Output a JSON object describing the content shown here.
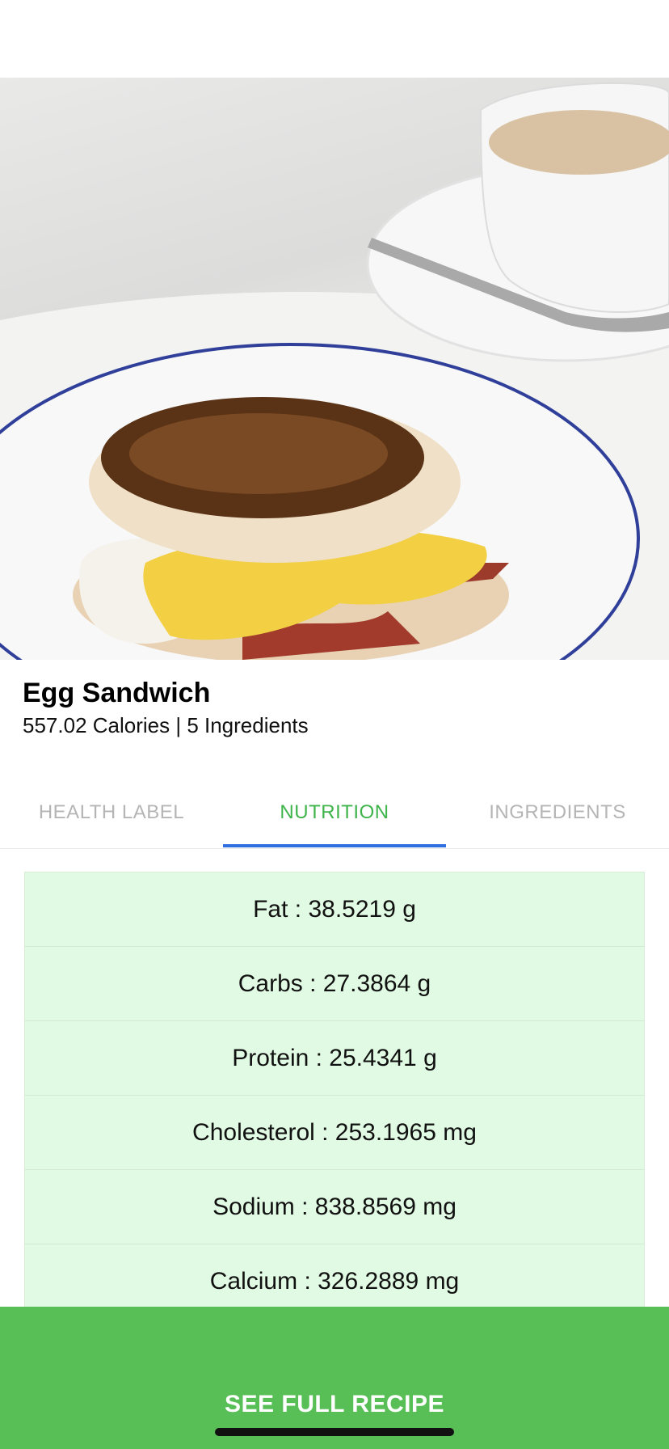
{
  "recipe": {
    "title": "Egg Sandwich",
    "subtitle": "557.02 Calories | 5 Ingredients",
    "image_alt": "Egg sandwich on a plate with coffee cup"
  },
  "tabs": [
    {
      "label": "HEALTH LABEL",
      "active": false
    },
    {
      "label": "NUTRITION",
      "active": true
    },
    {
      "label": "INGREDIENTS",
      "active": false
    }
  ],
  "nutrition": [
    "Fat : 38.5219 g",
    "Carbs : 27.3864 g",
    "Protein : 25.4341 g",
    "Cholesterol : 253.1965 mg",
    "Sodium : 838.8569 mg",
    "Calcium : 326.2889 mg"
  ],
  "cta": {
    "label": "SEE FULL RECIPE"
  },
  "colors": {
    "accent_green": "#3fb44b",
    "button_green": "#58bf57",
    "tab_indicator": "#2f6fe0",
    "row_bg": "#e1fae3"
  }
}
